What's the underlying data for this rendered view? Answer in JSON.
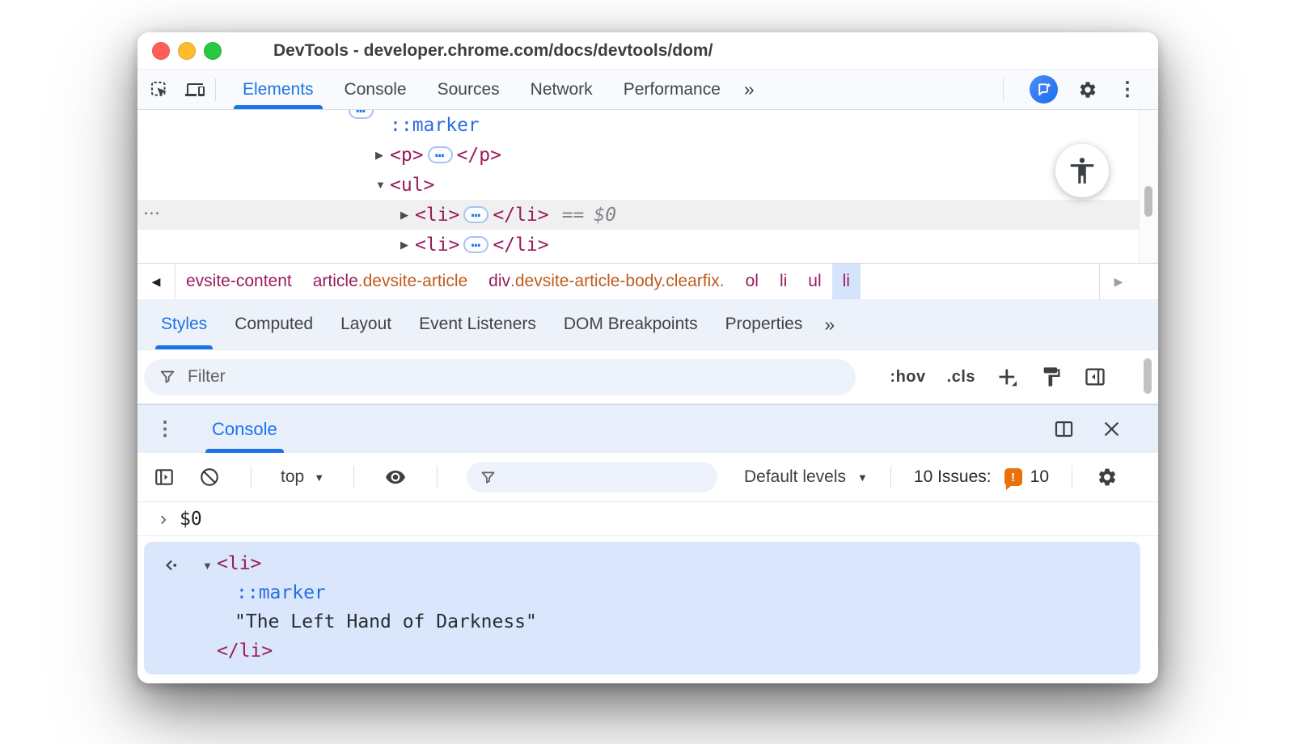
{
  "window_title": "DevTools - developer.chrome.com/docs/devtools/dom/",
  "colors": {
    "accent": "#1a73e8",
    "tag": "#9b1b5e",
    "class_attr": "#bf5b1d",
    "pseudo_blue": "#2b6be0",
    "selection_bg": "#d9e6fc",
    "selected_row_bg": "#f0f0f1",
    "issues_orange": "#e8710a",
    "traffic_red": "#ff5f57",
    "traffic_yellow": "#febc2e",
    "traffic_green": "#28c840"
  },
  "icons": {
    "overflow": "»",
    "kebab": "⋮",
    "gutter_dots": "⋯",
    "expand": "▶",
    "collapse": "▼",
    "dropdown": "▼",
    "breadcrumb_prev": "◀",
    "breadcrumb_next": "▶",
    "ellipsis": "…",
    "prompt": "›",
    "issues_mark": "!"
  },
  "main_toolbar": {
    "tabs": [
      {
        "label": "Elements",
        "active": true
      },
      {
        "label": "Console"
      },
      {
        "label": "Sources"
      },
      {
        "label": "Network"
      },
      {
        "label": "Performance"
      }
    ]
  },
  "dom_tree": {
    "pseudo_row": {
      "label": "::marker"
    },
    "p_row": {
      "open": "<p>",
      "close": "</p>"
    },
    "ul_row": {
      "open": "<ul>"
    },
    "li_selected_row": {
      "open": "<li>",
      "close": "</li>",
      "eq": "==",
      "var": "$0"
    },
    "li_row": {
      "open": "<li>",
      "close": "</li>"
    }
  },
  "breadcrumb": {
    "items": [
      {
        "tag": "evsite-content",
        "classes": ""
      },
      {
        "tag": "article",
        "classes": ".devsite-article"
      },
      {
        "tag": "div",
        "classes": ".devsite-article-body.clearfix."
      },
      {
        "tag": "ol",
        "classes": ""
      },
      {
        "tag": "li",
        "classes": ""
      },
      {
        "tag": "ul",
        "classes": ""
      },
      {
        "tag": "li",
        "classes": "",
        "selected": true
      }
    ]
  },
  "styles_panel": {
    "tabs": [
      "Styles",
      "Computed",
      "Layout",
      "Event Listeners",
      "DOM Breakpoints",
      "Properties"
    ],
    "active_tab": "Styles",
    "filter_placeholder": "Filter",
    "pseudo_toggle": ":hov",
    "class_toggle": ".cls"
  },
  "drawer": {
    "tab": "Console"
  },
  "console_toolbar": {
    "context": "top",
    "levels": "Default levels",
    "issues_label": "10 Issues:",
    "issues_count": "10",
    "filter_value": ""
  },
  "console": {
    "command": "$0",
    "result": {
      "open": "<li>",
      "pseudo": "::marker",
      "string": "\"The Left Hand of Darkness\"",
      "close": "</li>"
    }
  }
}
